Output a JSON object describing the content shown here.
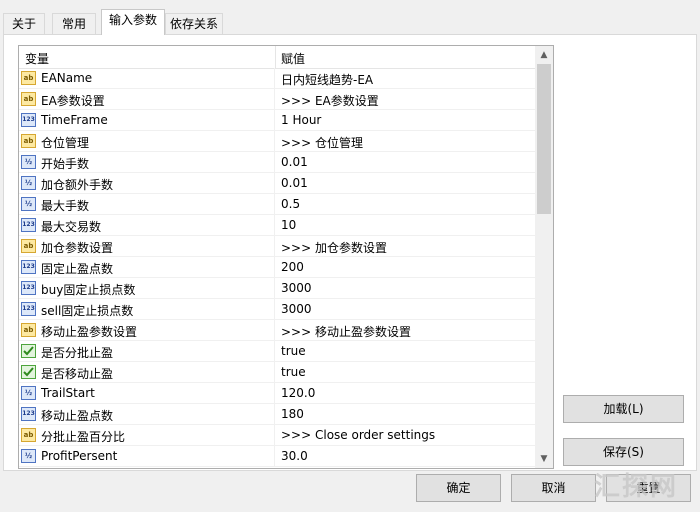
{
  "tabs": [
    {
      "label": "关于"
    },
    {
      "label": "常用"
    },
    {
      "label": "输入参数"
    },
    {
      "label": "依存关系"
    }
  ],
  "grid": {
    "col_variable": "变量",
    "col_value": "赋值",
    "rows": [
      {
        "icon": "ab",
        "name": "EAName",
        "value": "日内短线趋势-EA"
      },
      {
        "icon": "ab",
        "name": "EA参数设置",
        "value": ">>> EA参数设置"
      },
      {
        "icon": "123",
        "name": "TimeFrame",
        "value": "1 Hour"
      },
      {
        "icon": "ab",
        "name": "仓位管理",
        "value": ">>> 仓位管理"
      },
      {
        "icon": "1/2",
        "name": "开始手数",
        "value": "0.01"
      },
      {
        "icon": "1/2",
        "name": "加仓额外手数",
        "value": "0.01"
      },
      {
        "icon": "1/2",
        "name": "最大手数",
        "value": "0.5"
      },
      {
        "icon": "123",
        "name": "最大交易数",
        "value": "10"
      },
      {
        "icon": "ab",
        "name": "加仓参数设置",
        "value": ">>> 加仓参数设置"
      },
      {
        "icon": "123",
        "name": "固定止盈点数",
        "value": "200"
      },
      {
        "icon": "123",
        "name": "buy固定止损点数",
        "value": "3000"
      },
      {
        "icon": "123",
        "name": "sell固定止损点数",
        "value": "3000"
      },
      {
        "icon": "ab",
        "name": "移动止盈参数设置",
        "value": ">>> 移动止盈参数设置"
      },
      {
        "icon": "check",
        "name": "是否分批止盈",
        "value": "true"
      },
      {
        "icon": "check",
        "name": "是否移动止盈",
        "value": "true"
      },
      {
        "icon": "1/2",
        "name": "TrailStart",
        "value": "120.0"
      },
      {
        "icon": "123",
        "name": "移动止盈点数",
        "value": "180"
      },
      {
        "icon": "ab",
        "name": "分批止盈百分比",
        "value": ">>> Close order settings"
      },
      {
        "icon": "1/2",
        "name": "ProfitPersent",
        "value": "30.0"
      }
    ]
  },
  "buttons": {
    "load": "加载(L)",
    "save": "保存(S)",
    "ok": "确定",
    "cancel": "取消",
    "reset": "重置"
  },
  "watermark": "汇探网"
}
